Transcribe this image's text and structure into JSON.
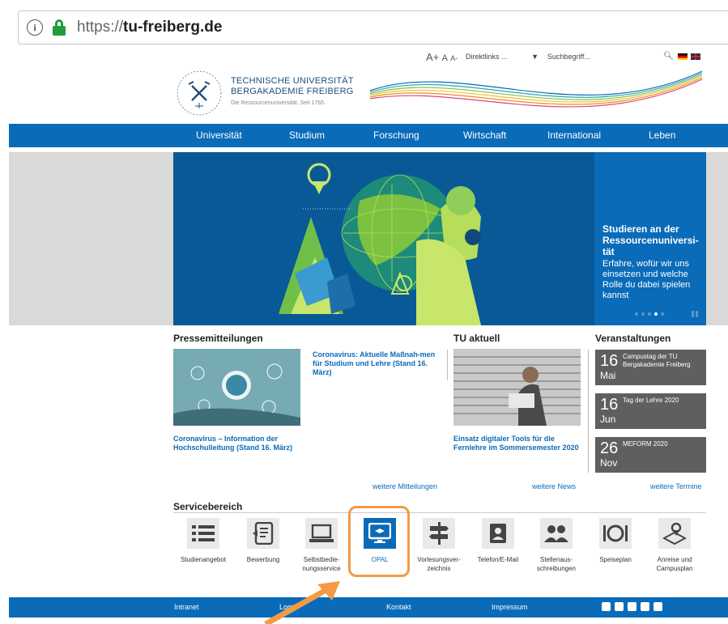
{
  "browser": {
    "url_prefix": "https://",
    "url_host": "tu-freiberg.de"
  },
  "utility": {
    "font_sizes": [
      "A+",
      "A",
      "A-"
    ],
    "direct_links": "Direktlinks ...",
    "search_placeholder": "Suchbegriff..."
  },
  "logo": {
    "line1": "TECHNISCHE UNIVERSITÄT",
    "line2": "BERGAKADEMIE FREIBERG",
    "tagline": "Die Ressourcenuniversität. Seit 1765."
  },
  "nav": {
    "items": [
      "Universität",
      "Studium",
      "Forschung",
      "Wirtschaft",
      "International",
      "Leben"
    ]
  },
  "hero": {
    "heading": "Studieren an der Ressourcenuniversi-tät",
    "text": "Erfahre, wofür wir uns einsetzen und welche Rolle du dabei spielen kannst"
  },
  "press": {
    "title": "Pressemitteilungen",
    "item1": "Coronavirus – Information der Hochschulleitung (Stand 16. März)",
    "item2": "Coronavirus: Aktuelle Maßnah-men für Studium und Lehre (Stand 16. März)",
    "more": "weitere Mitteilungen"
  },
  "tu_aktuell": {
    "title": "TU aktuell",
    "item1": "Einsatz digitaler Tools für die Fernlehre im Sommersemester 2020",
    "more": "weitere News"
  },
  "events": {
    "title": "Veranstaltungen",
    "items": [
      {
        "day": "16",
        "month": "Mai",
        "title": "Campustag der TU Bergakademie Freiberg"
      },
      {
        "day": "16",
        "month": "Jun",
        "title": "Tag der Lehre 2020"
      },
      {
        "day": "26",
        "month": "Nov",
        "title": "MEFORM 2020"
      }
    ],
    "more": "weitere Termine"
  },
  "service": {
    "title": "Servicebereich",
    "items": [
      {
        "label": "Studienangebot",
        "icon": "list-icon"
      },
      {
        "label": "Bewerbung",
        "icon": "application-icon"
      },
      {
        "label": "Selbstbedie-nungsservice",
        "icon": "laptop-icon"
      },
      {
        "label": "OPAL",
        "icon": "elearning-icon"
      },
      {
        "label": "Vorlesungsver-zeichnis",
        "icon": "signpost-icon"
      },
      {
        "label": "Telefon/E-Mail",
        "icon": "contact-icon"
      },
      {
        "label": "Stellenaus-schreibungen",
        "icon": "people-icon"
      },
      {
        "label": "Speiseplan",
        "icon": "dining-icon"
      },
      {
        "label": "Anreise und Campusplan",
        "icon": "map-pin-icon"
      }
    ]
  },
  "footer": {
    "items": [
      "Intranet",
      "Login",
      "Kontakt",
      "Impressum"
    ]
  },
  "colors": {
    "brand_blue": "#0a6bb8",
    "highlight_orange": "#f39a45",
    "event_gray": "#5f5f5f"
  }
}
